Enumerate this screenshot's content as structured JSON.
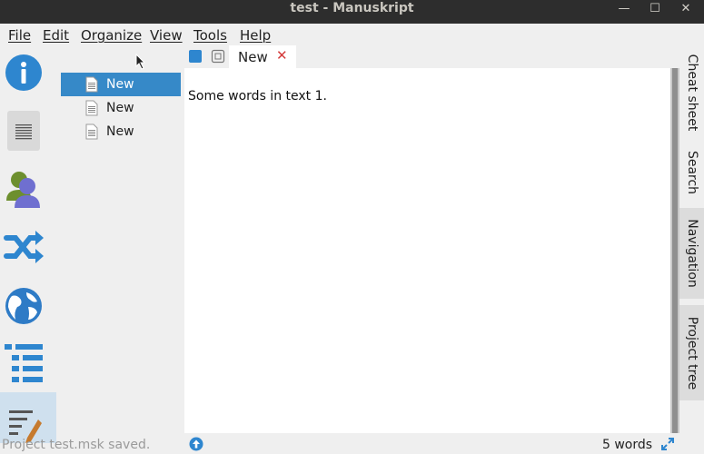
{
  "window": {
    "title": "test - Manuskript",
    "minimize_glyph": "—",
    "maximize_glyph": "☐",
    "close_glyph": "✕"
  },
  "menu": [
    "File",
    "Edit",
    "Organize",
    "View",
    "Tools",
    "Help"
  ],
  "left_toolbar": {
    "icons": [
      "info-icon",
      "summary-icon",
      "characters-icon",
      "plots-icon",
      "world-icon",
      "outline-icon",
      "editor-icon"
    ],
    "selected": "editor-icon"
  },
  "tree": {
    "items": [
      {
        "label": "New",
        "selected": true
      },
      {
        "label": "New",
        "selected": false
      },
      {
        "label": "New",
        "selected": false
      }
    ]
  },
  "tabs": {
    "active_label": "New",
    "close_glyph": "✕"
  },
  "editor": {
    "content": "Some words in text 1."
  },
  "right_tabs": [
    "Cheat sheet",
    "Search",
    "Navigation",
    "Project tree"
  ],
  "status": {
    "message": "Project test.msk saved.",
    "word_count": "5 words"
  },
  "colors": {
    "accent": "#3689c8",
    "titlebar": "#2d2d2d",
    "close_tab": "#d43b3b"
  }
}
